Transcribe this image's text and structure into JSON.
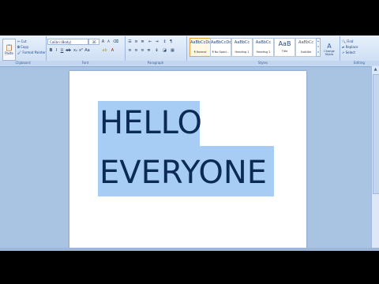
{
  "clipboard": {
    "paste_label": "Paste",
    "cut_label": "Cut",
    "copy_label": "Copy",
    "format_painter_label": "Format Painter",
    "group_label": "Clipboard"
  },
  "font": {
    "font_name": "Calibri (Body)",
    "font_size": "36",
    "group_label": "Font"
  },
  "paragraph": {
    "group_label": "Paragraph"
  },
  "styles": {
    "group_label": "Styles",
    "items": [
      {
        "sample": "AaBbCcDc",
        "name": "¶ Normal"
      },
      {
        "sample": "AaBbCcDc",
        "name": "¶ No Spaci..."
      },
      {
        "sample": "AaBbCc",
        "name": "Heading 1"
      },
      {
        "sample": "AaBbCc",
        "name": "Heading 2"
      },
      {
        "sample": "AaB",
        "name": "Title"
      },
      {
        "sample": "AaBbCc",
        "name": "Subtitle"
      }
    ],
    "change_styles_label": "Change Styles"
  },
  "editing": {
    "group_label": "Editing",
    "find_label": "Find",
    "replace_label": "Replace",
    "select_label": "Select"
  },
  "document": {
    "lines": [
      "HELLO",
      "EVERYONE"
    ]
  }
}
